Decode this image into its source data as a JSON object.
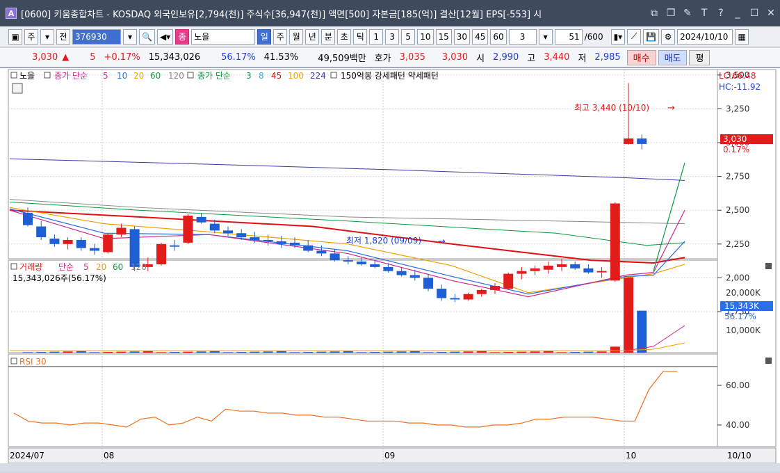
{
  "window": {
    "app_icon": "A",
    "title": "[0600] 키움종합차트 - KOSDAQ 외국인보유[2,794(천)] 주식수[36,947(천)] 액면[500] 자본금[185(억)] 결산[12월] EPS[-553] 시",
    "controls": [
      "restore-icon",
      "copy-icon",
      "tool-icon",
      "T",
      "?",
      "minimize-icon",
      "maximize-icon",
      "close-icon"
    ]
  },
  "toolbar": {
    "mode_label": "주",
    "range_label": "전",
    "stock_code": "376930",
    "stock_name": "노을",
    "stock_badge": "종",
    "periods": [
      "일",
      "주",
      "월",
      "년",
      "분",
      "초",
      "틱"
    ],
    "minutes": [
      "1",
      "3",
      "5",
      "10",
      "15",
      "30",
      "45",
      "60"
    ],
    "interval_value": "3",
    "count_value": "51",
    "count_total": "/600",
    "date_value": "2024/10/10"
  },
  "quote": {
    "price": "3,030",
    "change_arrow": "▲",
    "change": "5",
    "change_pct": "+0.17%",
    "volume": "15,343,026",
    "vol_ratio": "56.17%",
    "turnover_pct": "41.53%",
    "amount": "49,509백만",
    "ask_label": "호가",
    "ask": "3,035",
    "bid": "3,030",
    "open_label": "시",
    "open": "2,990",
    "high_label": "고",
    "high": "3,440",
    "low_label": "저",
    "low": "2,985",
    "buy_label": "매수",
    "sell_label": "매도",
    "avg_label": "평"
  },
  "price_pane": {
    "legend": {
      "name": "노을",
      "ma1_label": "종가 단순",
      "ma1_periods": [
        "5",
        "10",
        "20",
        "60",
        "120"
      ],
      "ma2_label": "종가 단순",
      "ma2_periods": [
        "3",
        "8",
        "45",
        "100",
        "224"
      ],
      "extra": "150억봉 강세패턴 약세패턴"
    },
    "lc": "LC:66.48",
    "hc": "HC:-11.92",
    "yticks": [
      "3,500",
      "3,250",
      "3,000",
      "2,750",
      "2,500",
      "2,250",
      "2,000",
      "1,750"
    ],
    "high_annotation": "최고 3,440 (10/10)",
    "low_annotation": "최저 1,820 (09/09)",
    "last_price_tag": "3,030",
    "last_change_tag": "0.17%"
  },
  "volume_pane": {
    "legend_name": "거래량",
    "legend_ma": "단순",
    "periods": [
      "5",
      "20",
      "60",
      "120"
    ],
    "info": "15,343,026주(56.17%)",
    "yticks": [
      "20,000K",
      "10,000K"
    ],
    "vol_tag": "15,343K",
    "pct_tag": "56.17%"
  },
  "rsi_pane": {
    "legend": "RSI 30",
    "yticks": [
      "60.00",
      "40.00"
    ]
  },
  "xaxis": {
    "labels": [
      "2024/07",
      "08",
      "09",
      "10"
    ],
    "right_label": "10/10"
  },
  "colors": {
    "up": "#e21b1b",
    "down": "#1f5fd6",
    "ma5": "#d0288c",
    "ma10": "#2a6ee8",
    "ma20": "#f0a000",
    "ma60": "#0a9a3a",
    "ma120": "#888888",
    "ma_red": "#e01010",
    "ma_long": "#3b3ba0",
    "rsi": "#f07020"
  }
}
